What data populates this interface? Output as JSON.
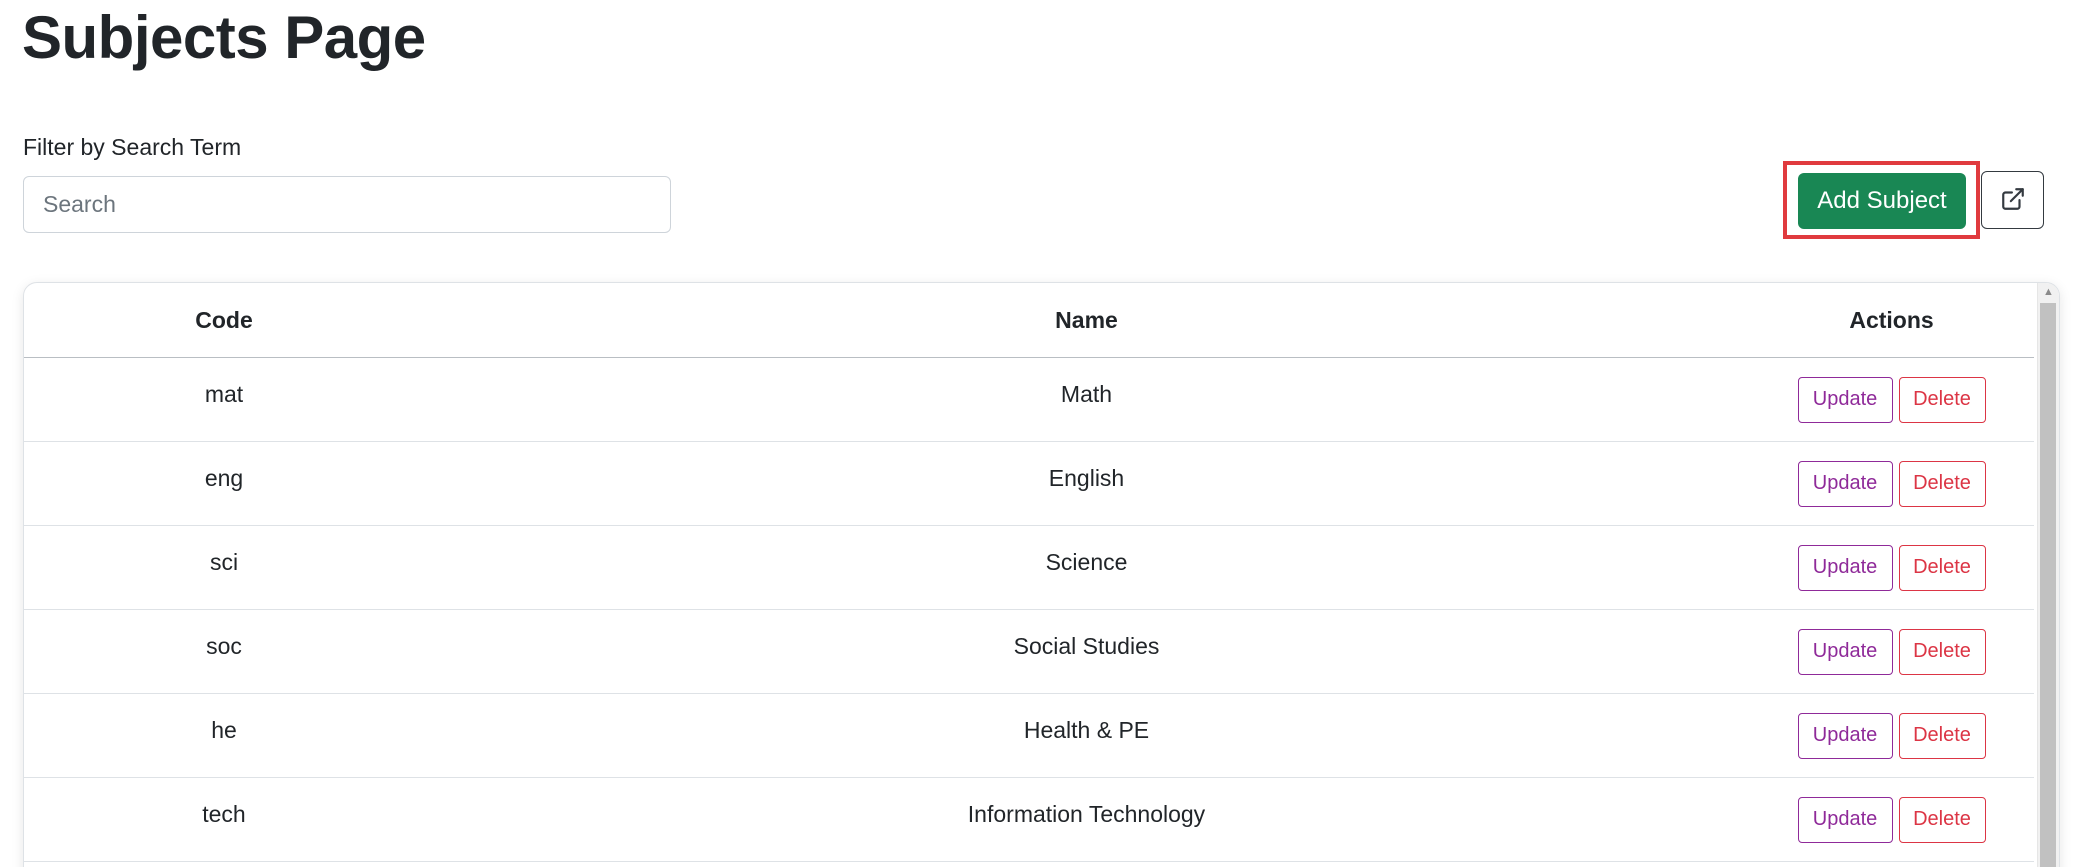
{
  "page": {
    "title": "Subjects Page"
  },
  "filter": {
    "label": "Filter by Search Term",
    "placeholder": "Search",
    "value": ""
  },
  "toolbar": {
    "add_label": "Add Subject",
    "external_icon": "external-link-icon"
  },
  "colors": {
    "add_button": "#198754",
    "update": "#8f2a99",
    "delete": "#dc3545",
    "highlight": "#e03a3e"
  },
  "table": {
    "headers": [
      "Code",
      "Name",
      "Actions"
    ],
    "rows": [
      {
        "code": "mat",
        "name": "Math"
      },
      {
        "code": "eng",
        "name": "English"
      },
      {
        "code": "sci",
        "name": "Science"
      },
      {
        "code": "soc",
        "name": "Social Studies"
      },
      {
        "code": "he",
        "name": "Health & PE"
      },
      {
        "code": "tech",
        "name": "Information Technology"
      }
    ],
    "update_label": "Update",
    "delete_label": "Delete"
  }
}
